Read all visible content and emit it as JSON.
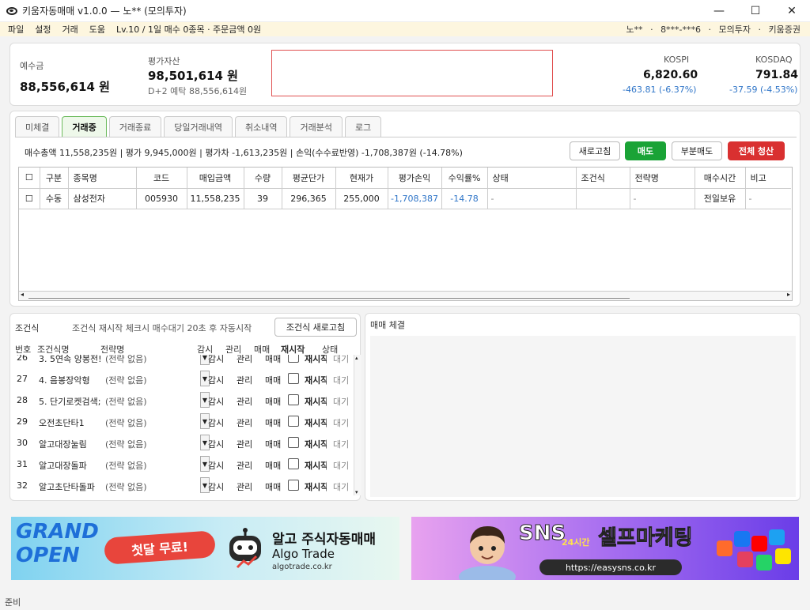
{
  "window": {
    "title": "키움자동매매 v1.0.0 — 노** (모의투자)"
  },
  "menu": {
    "items": [
      "파일",
      "설정",
      "거래",
      "도움"
    ],
    "status": "Lv.10 / 1일 매수 0종목 · 주문금액 0원",
    "user": [
      "노**",
      "·",
      "8***-***6",
      "·",
      "모의투자",
      "·",
      "키움증권"
    ]
  },
  "summary": {
    "deposit_label": "예수금",
    "deposit_value": "88,556,614 원",
    "asset_label": "평가자산",
    "asset_value": "98,501,614 원",
    "d2_label": "D+2 예탁",
    "d2_value": "88,556,614원",
    "kospi": {
      "label": "KOSPI",
      "value": "6,820.60",
      "change": "-463.81 (-6.37%)"
    },
    "kosdaq": {
      "label": "KOSDAQ",
      "value": "791.84",
      "change": "-37.59 (-4.53%)"
    }
  },
  "tabs": [
    "미체결",
    "거래중",
    "거래종료",
    "당일거래내역",
    "취소내역",
    "거래분석",
    "로그"
  ],
  "trade": {
    "summary_text": "매수총액 11,558,235원  |  평가 9,945,000원  |  평가차 -1,613,235원  |  손익(수수료반영) -1,708,387원 (-14.78%)",
    "buttons": {
      "refresh": "새로고침",
      "sell": "매도",
      "partial": "부분매도",
      "liquidate": "전체 청산"
    },
    "columns": [
      "☐",
      "구분",
      "종목명",
      "코드",
      "매입금액",
      "수량",
      "평균단가",
      "현재가",
      "평가손익",
      "수익률%",
      "상태",
      "조건식",
      "전략명",
      "매수시간",
      "비고"
    ],
    "rows": [
      [
        "☐",
        "수동",
        "삼성전자",
        "005930",
        "11,558,235",
        "39",
        "296,365",
        "255,000",
        "-1,708,387",
        "-14.78",
        "-",
        "",
        "-",
        "전일보유",
        "-"
      ]
    ]
  },
  "conditions": {
    "title": "조건식",
    "note": "조건식 재시작 체크시 매수대기 20초 후 자동시작",
    "refresh": "조건식 새로고침",
    "headers": [
      "번호",
      "조건식명",
      "전략명",
      "감시",
      "관리",
      "매매",
      "재시작",
      "상태"
    ],
    "rows": [
      {
        "no": "26",
        "name": "3. 5연속 양봉전!",
        "strategy": "(전략 없음)"
      },
      {
        "no": "27",
        "name": "4. 음봉장악형",
        "strategy": "(전략 없음)"
      },
      {
        "no": "28",
        "name": "5. 단기로켓검색;",
        "strategy": "(전략 없음)"
      },
      {
        "no": "29",
        "name": "오전초단타1",
        "strategy": "(전략 없음)"
      },
      {
        "no": "30",
        "name": "알고대장눌림",
        "strategy": "(전략 없음)"
      },
      {
        "no": "31",
        "name": "알고대장돌파",
        "strategy": "(전략 없음)"
      },
      {
        "no": "32",
        "name": "알고초단타돌파",
        "strategy": "(전략 없음)"
      }
    ],
    "watch": "감시",
    "manage": "관리",
    "trade": "매매",
    "restart": "재시작",
    "state": "대기"
  },
  "execution": {
    "title": "매매 체결"
  },
  "ads": {
    "ad1": {
      "grand": "GRAND",
      "open": "OPEN",
      "free": "첫달 무료!",
      "headline": "알고 주식자동매매",
      "brand": "Algo Trade",
      "url": "algotrade.co.kr"
    },
    "ad2": {
      "sns": "SNS",
      "hours": "24시간",
      "headline": "셀프마케팅",
      "url": "https://easysns.co.kr"
    }
  },
  "status": "준비",
  "colors": {
    "green": "#1aa336",
    "red": "#d93030",
    "blue": "#2f75c8",
    "tab_active": "#eef8ea"
  }
}
